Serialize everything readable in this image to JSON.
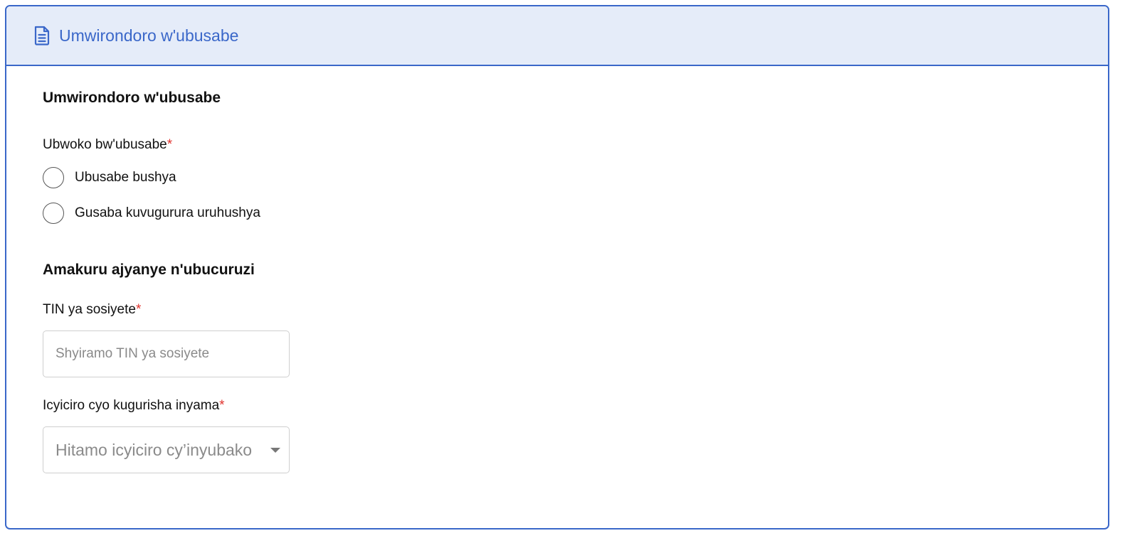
{
  "header": {
    "icon": "document-icon",
    "title": "Umwirondoro w'ubusabe"
  },
  "section1": {
    "title": "Umwirondoro w'ubusabe",
    "request_type": {
      "label": "Ubwoko bw'ubusabe",
      "required_mark": "*",
      "options": [
        {
          "label": "Ubusabe bushya",
          "selected": false
        },
        {
          "label": "Gusaba kuvugurura uruhushya",
          "selected": false
        }
      ]
    }
  },
  "section2": {
    "title": "Amakuru ajyanye n'ubucuruzi",
    "tin": {
      "label": "TIN ya sosiyete",
      "required_mark": "*",
      "value": "",
      "placeholder": "Shyiramo TIN ya sosiyete"
    },
    "category": {
      "label": "Icyiciro cyo kugurisha inyama",
      "required_mark": "*",
      "placeholder": "Hitamo icyiciro cy’inyubako"
    }
  },
  "colors": {
    "accent": "#3a67c9",
    "header_bg": "#e5ecf9",
    "required": "#e0322d"
  }
}
